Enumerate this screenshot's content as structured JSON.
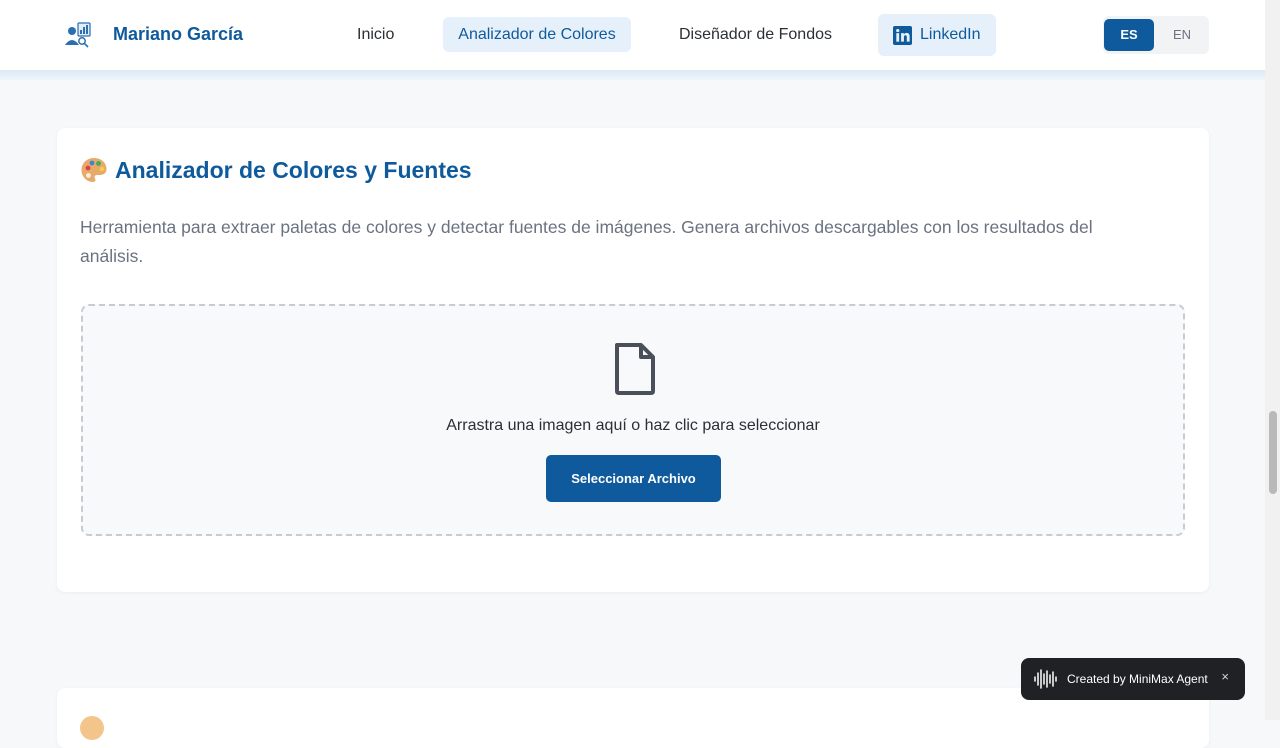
{
  "brand": {
    "name": "Mariano García",
    "logo_icon": "analyst-person-icon"
  },
  "nav": {
    "items": [
      {
        "label": "Inicio",
        "active": false
      },
      {
        "label": "Analizador de Colores",
        "active": true
      },
      {
        "label": "Diseñador de Fondos",
        "active": false
      },
      {
        "label": "LinkedIn",
        "icon": "linkedin-icon",
        "active": false
      }
    ]
  },
  "language": {
    "options": [
      "ES",
      "EN"
    ],
    "selected": "ES"
  },
  "analyzer": {
    "title_icon": "palette-icon",
    "title": "Analizador de Colores y Fuentes",
    "description": "Herramienta para extraer paletas de colores y detectar fuentes de imágenes. Genera archivos descargables con los resultados del análisis.",
    "dropzone": {
      "icon": "file-icon",
      "text": "Arrastra una imagen aquí o haz clic para seleccionar",
      "button_label": "Seleccionar Archivo"
    }
  },
  "badge": {
    "text": "Created by MiniMax Agent",
    "icon": "soundwave-icon",
    "close": "×"
  },
  "colors": {
    "primary": "#0f5a9c",
    "active_bg": "#e6f0fa",
    "page_bg": "#f7f8fa",
    "badge_bg": "#1f2125"
  }
}
